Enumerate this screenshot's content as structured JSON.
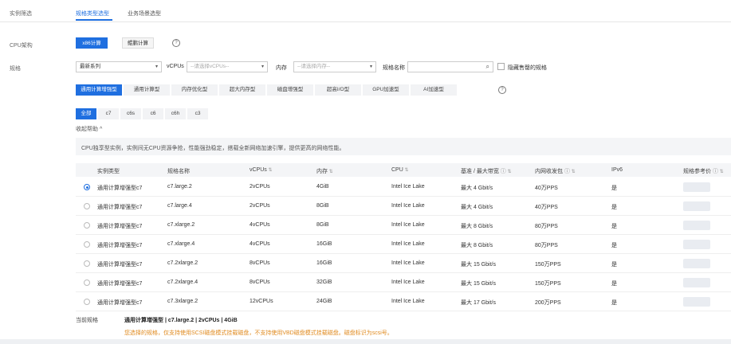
{
  "left_labels": {
    "filter": "实例筛选",
    "cpu_arch": "CPU架构",
    "spec": "规格"
  },
  "tabs": [
    {
      "label": "规格类型选型"
    },
    {
      "label": "业务场景选型"
    }
  ],
  "cpu_arch": {
    "options": [
      "x86计算",
      "鲲鹏计算"
    ],
    "selected": "x86计算"
  },
  "filters": {
    "series_value": "最新系列",
    "vcpus_label": "vCPUs",
    "vcpus_placeholder": "--请选择vCPUs--",
    "memory_label": "内存",
    "memory_placeholder": "--请选择内存--",
    "name_label": "规格名称",
    "hide_soldout_label": "隐藏售罄的规格"
  },
  "categories": [
    "通用计算增强型",
    "通用计算型",
    "内存优化型",
    "超大内存型",
    "磁盘增强型",
    "超高I/O型",
    "GPU加速型",
    "AI加速型"
  ],
  "subtypes": [
    "全部",
    "c7",
    "c6s",
    "c6",
    "c6h",
    "c3"
  ],
  "collapse_label": "收起帮助 ^",
  "help_text": "CPU独享型实例，实例间无CPU资源争抢，性能强劲稳定，搭载全新网络加速引擎，提供更高的网络性能。",
  "table": {
    "columns": [
      "实例类型",
      "规格名称",
      "vCPUs",
      "内存",
      "CPU",
      "基准 / 最大带宽",
      "内网收发包",
      "IPv6",
      "规格参考价"
    ],
    "rows": [
      {
        "type": "通用计算增强型c7",
        "name": "c7.large.2",
        "vcpus": "2vCPUs",
        "mem": "4GiB",
        "cpu": "Intel Ice Lake",
        "bw": "最大 4 Gbit/s",
        "pps": "40万PPS",
        "ipv6": "是",
        "selected": true
      },
      {
        "type": "通用计算增强型c7",
        "name": "c7.large.4",
        "vcpus": "2vCPUs",
        "mem": "8GiB",
        "cpu": "Intel Ice Lake",
        "bw": "最大 4 Gbit/s",
        "pps": "40万PPS",
        "ipv6": "是",
        "selected": false
      },
      {
        "type": "通用计算增强型c7",
        "name": "c7.xlarge.2",
        "vcpus": "4vCPUs",
        "mem": "8GiB",
        "cpu": "Intel Ice Lake",
        "bw": "最大 8 Gbit/s",
        "pps": "80万PPS",
        "ipv6": "是",
        "selected": false
      },
      {
        "type": "通用计算增强型c7",
        "name": "c7.xlarge.4",
        "vcpus": "4vCPUs",
        "mem": "16GiB",
        "cpu": "Intel Ice Lake",
        "bw": "最大 8 Gbit/s",
        "pps": "80万PPS",
        "ipv6": "是",
        "selected": false
      },
      {
        "type": "通用计算增强型c7",
        "name": "c7.2xlarge.2",
        "vcpus": "8vCPUs",
        "mem": "16GiB",
        "cpu": "Intel Ice Lake",
        "bw": "最大 15 Gbit/s",
        "pps": "150万PPS",
        "ipv6": "是",
        "selected": false
      },
      {
        "type": "通用计算增强型c7",
        "name": "c7.2xlarge.4",
        "vcpus": "8vCPUs",
        "mem": "32GiB",
        "cpu": "Intel Ice Lake",
        "bw": "最大 15 Gbit/s",
        "pps": "150万PPS",
        "ipv6": "是",
        "selected": false
      },
      {
        "type": "通用计算增强型c7",
        "name": "c7.3xlarge.2",
        "vcpus": "12vCPUs",
        "mem": "24GiB",
        "cpu": "Intel Ice Lake",
        "bw": "最大 17 Gbit/s",
        "pps": "200万PPS",
        "ipv6": "是",
        "selected": false
      }
    ]
  },
  "current": {
    "label": "当前规格",
    "value": "通用计算增强型 | c7.large.2 | 2vCPUs | 4GiB",
    "notice": "您选择的规格，仅支持使用SCSI磁盘模式挂载磁盘，不支持使用VBD磁盘模式挂载磁盘。磁盘标识为scsi号。"
  },
  "colors": {
    "accent": "#1f6fe0",
    "notice": "#e08a1e"
  },
  "icons": [
    "help-icon",
    "search-icon",
    "sort-icon",
    "chevron-down-icon"
  ]
}
